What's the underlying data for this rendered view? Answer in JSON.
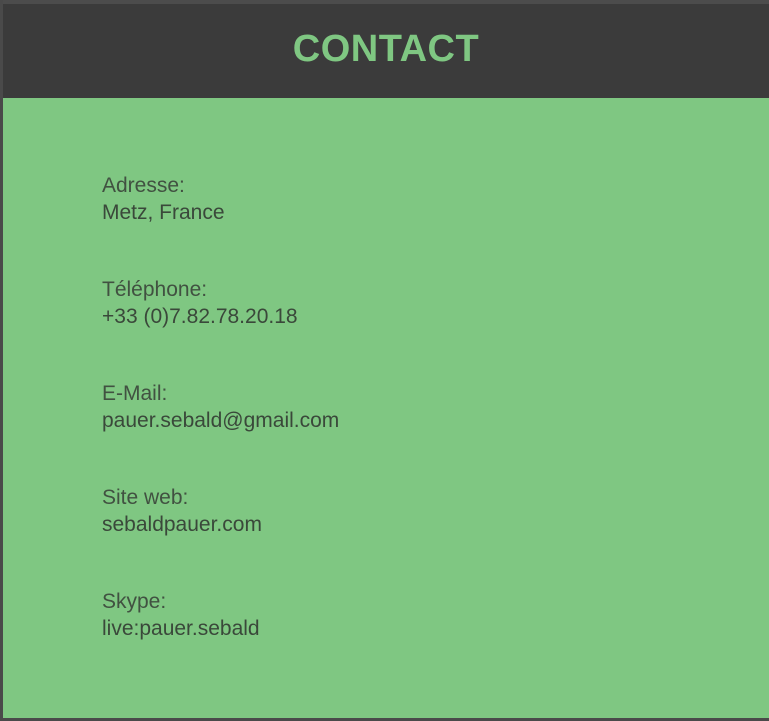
{
  "header": {
    "title": "CONTACT"
  },
  "contact": {
    "items": [
      {
        "label": "Adresse:",
        "value": "Metz, France"
      },
      {
        "label": "Téléphone:",
        "value": "+33 (0)7.82.78.20.18"
      },
      {
        "label": "E-Mail:",
        "value": "pauer.sebald@gmail.com"
      },
      {
        "label": "Site web:",
        "value": "sebaldpauer.com"
      },
      {
        "label": "Skype:",
        "value": "live:pauer.sebald"
      }
    ]
  },
  "colors": {
    "header_background": "#3b3b3b",
    "accent_green": "#7fc782",
    "text": "#3d4d3d"
  }
}
